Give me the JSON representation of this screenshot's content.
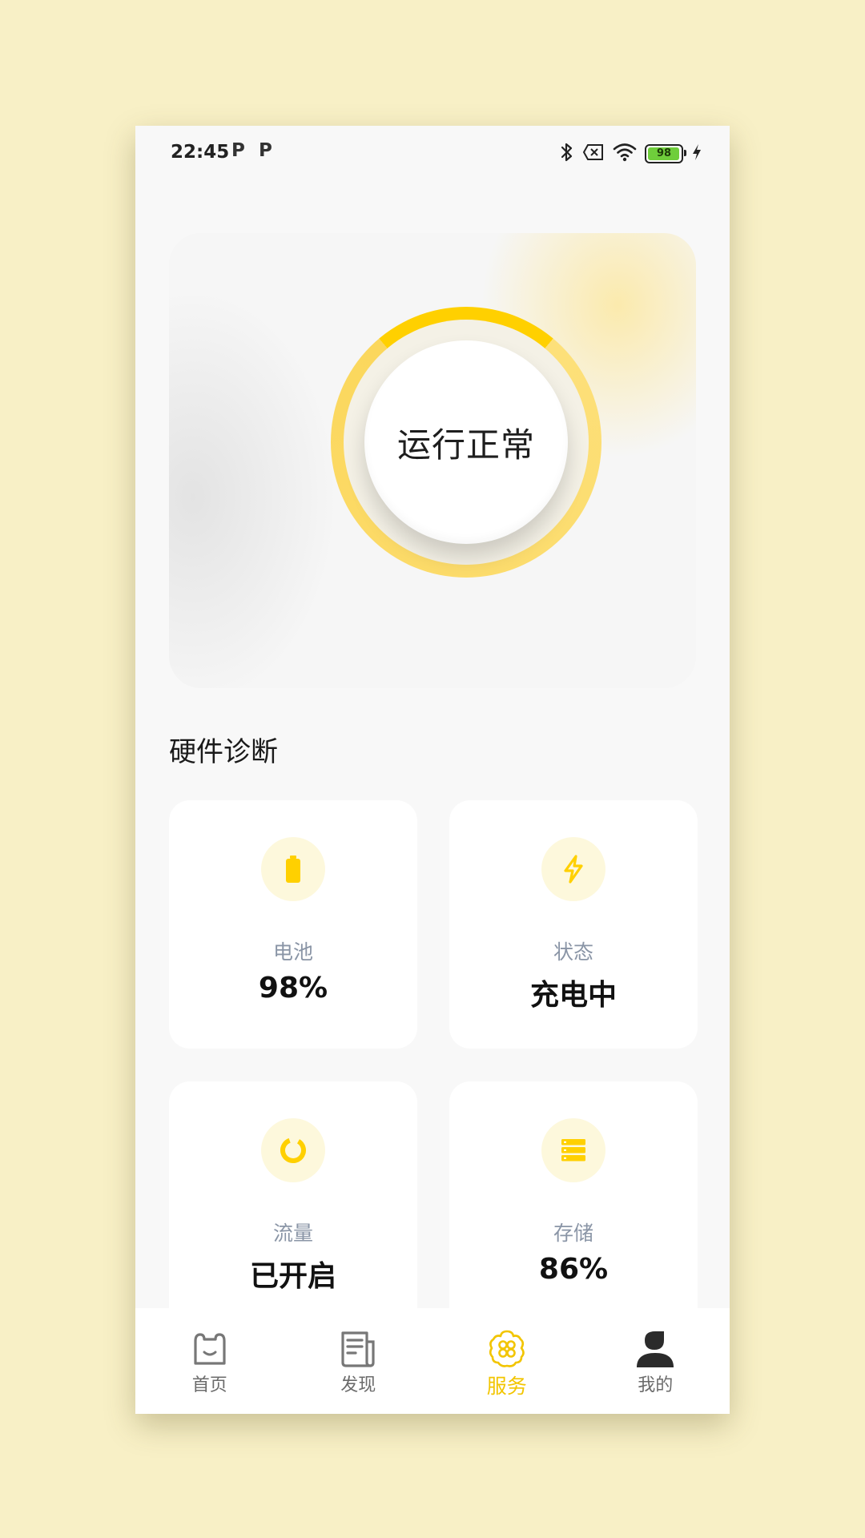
{
  "status_bar": {
    "time": "22:45",
    "notif_icon_1": "P",
    "notif_icon_2": "P",
    "battery_level": "98"
  },
  "hero": {
    "status_text": "运行正常"
  },
  "section": {
    "title": "硬件诊断"
  },
  "cards": [
    {
      "icon": "battery-icon",
      "label": "电池",
      "value": "98%"
    },
    {
      "icon": "bolt-icon",
      "label": "状态",
      "value": "充电中"
    },
    {
      "icon": "ring-icon",
      "label": "流量",
      "value": "已开启"
    },
    {
      "icon": "storage-icon",
      "label": "存储",
      "value": "86%"
    }
  ],
  "nav": [
    {
      "icon": "home-cat-icon",
      "label": "首页",
      "active": false
    },
    {
      "icon": "document-icon",
      "label": "发现",
      "active": false
    },
    {
      "icon": "flower-service-icon",
      "label": "服务",
      "active": true
    },
    {
      "icon": "user-icon",
      "label": "我的",
      "active": false
    }
  ],
  "colors": {
    "accent": "#ffd000",
    "page_background": "#f8f0c6",
    "label_gray": "#8a95a6"
  }
}
